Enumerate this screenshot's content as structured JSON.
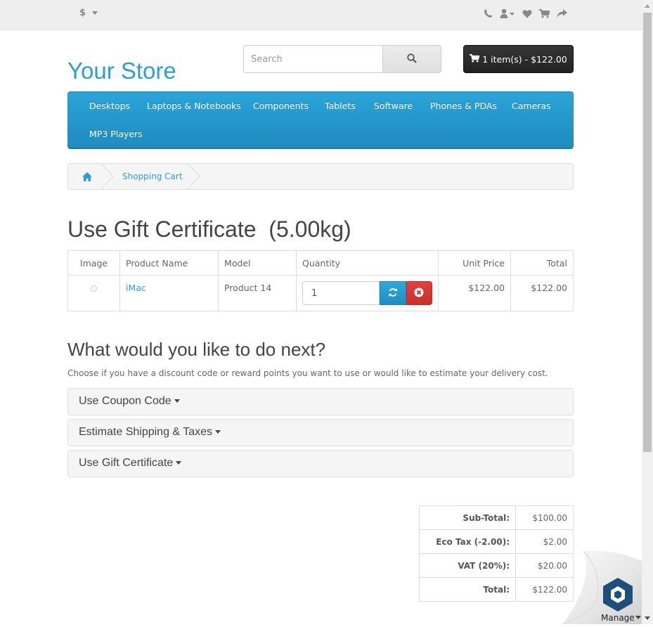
{
  "topbar": {
    "currency_symbol": "$",
    "icons": [
      "phone-icon",
      "user-icon",
      "heart-icon",
      "cart-icon",
      "share-icon"
    ]
  },
  "header": {
    "logo": "Your Store",
    "search_placeholder": "Search",
    "cart_label": "1 item(s) - $122.00"
  },
  "nav": {
    "items": [
      "Desktops",
      "Laptops & Notebooks",
      "Components",
      "Tablets",
      "Software",
      "Phones & PDAs",
      "Cameras",
      "MP3 Players"
    ]
  },
  "breadcrumb": {
    "items": [
      "Shopping Cart"
    ]
  },
  "page": {
    "title": "Use Gift Certificate  (5.00kg)"
  },
  "cart": {
    "headers": {
      "image": "Image",
      "name": "Product Name",
      "model": "Model",
      "quantity": "Quantity",
      "unit_price": "Unit Price",
      "total": "Total"
    },
    "rows": [
      {
        "name": "iMac",
        "model": "Product 14",
        "quantity": "1",
        "unit_price": "$122.00",
        "total": "$122.00"
      }
    ]
  },
  "next": {
    "title": "What would you like to do next?",
    "description": "Choose if you have a discount code or reward points you want to use or would like to estimate your delivery cost.",
    "panels": [
      "Use Coupon Code",
      "Estimate Shipping & Taxes",
      "Use Gift Certificate"
    ]
  },
  "totals": [
    {
      "label": "Sub-Total:",
      "value": "$100.00"
    },
    {
      "label": "Eco Tax (-2.00):",
      "value": "$2.00"
    },
    {
      "label": "VAT (20%):",
      "value": "$20.00"
    },
    {
      "label": "Total:",
      "value": "$122.00"
    }
  ],
  "manage": {
    "label": "Manage"
  },
  "colors": {
    "brand": "#2a9fd6",
    "danger": "#c9302c",
    "cart_button": "#222222"
  }
}
